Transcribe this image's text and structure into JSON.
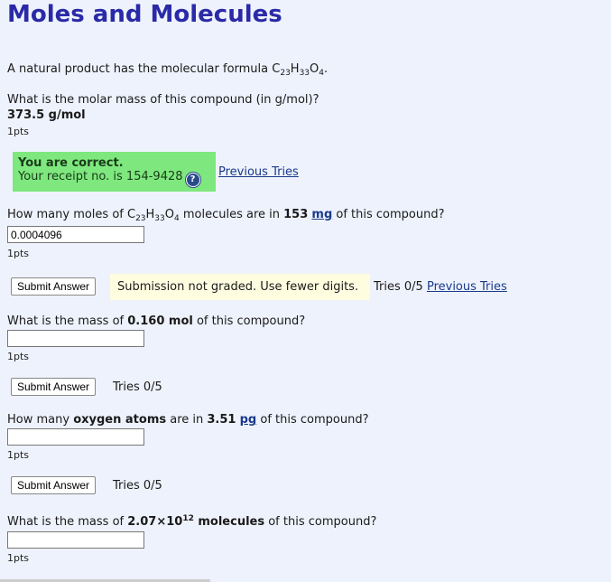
{
  "page": {
    "title": "Moles and Molecules"
  },
  "intro": {
    "prefix": "A natural product has the molecular formula ",
    "formula": {
      "c": "C",
      "c_n": "23",
      "h": "H",
      "h_n": "33",
      "o": "O",
      "o_n": "4"
    },
    "suffix": "."
  },
  "q1": {
    "question": "What is the molar mass of this compound (in g/mol)?",
    "answer": "373.5 g/mol",
    "pts": "1pts",
    "correct_title": "You are correct.",
    "receipt": "Your receipt no. is 154-9428",
    "previous_tries": "Previous Tries"
  },
  "q2": {
    "prefix": "How many moles of ",
    "mid": " molecules are in ",
    "amount": "153",
    "unit": "mg",
    "suffix": " of this compound?",
    "input_value": "0.0004096",
    "pts": "1pts",
    "submit": "Submit Answer",
    "message": "Submission not graded. Use fewer digits.",
    "tries": "Tries 0/5",
    "previous_tries": "Previous Tries"
  },
  "q3": {
    "prefix": "What is the mass of ",
    "amount": "0.160 mol",
    "suffix": " of this compound?",
    "input_value": "",
    "pts": "1pts",
    "submit": "Submit Answer",
    "tries": "Tries 0/5"
  },
  "q4": {
    "prefix": "How many ",
    "bold": "oxygen atoms",
    "mid": " are in ",
    "amount": "3.51",
    "unit": "pg",
    "suffix": " of this compound?",
    "input_value": "",
    "pts": "1pts",
    "submit": "Submit Answer",
    "tries": "Tries 0/5"
  },
  "q5": {
    "prefix": "What is the mass of ",
    "amount_base": "2.07×10",
    "amount_exp": "12",
    "bold": " molecules",
    "suffix": " of this compound?",
    "input_value": "",
    "pts": "1pts"
  },
  "colors": {
    "title": "#2a2aa8",
    "background": "#eef2fc",
    "correct_bg": "#7ee87e",
    "notice_bg": "#fffde0",
    "link": "#1a3a8a"
  },
  "icons": {
    "help": "question-circle-icon"
  }
}
